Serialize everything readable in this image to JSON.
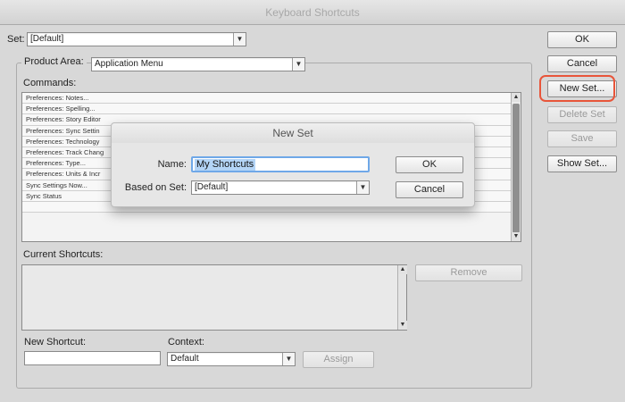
{
  "window": {
    "title": "Keyboard Shortcuts"
  },
  "set": {
    "label": "Set:",
    "value": "[Default]"
  },
  "product_area": {
    "label": "Product Area:",
    "value": "Application Menu"
  },
  "commands": {
    "label": "Commands:",
    "items": [
      "Preferences: Notes...",
      "Preferences: Spelling...",
      "Preferences: Story Editor",
      "Preferences: Sync Settin",
      "Preferences: Technology",
      "Preferences: Track Chang",
      "Preferences: Type...",
      "Preferences: Units & Incr",
      "Sync Settings Now...",
      "Sync Status",
      ""
    ]
  },
  "current_shortcuts": {
    "label": "Current Shortcuts:",
    "remove_label": "Remove"
  },
  "new_shortcut": {
    "label": "New Shortcut:",
    "value": ""
  },
  "context": {
    "label": "Context:",
    "value": "Default",
    "assign_label": "Assign"
  },
  "side_buttons": {
    "ok": "OK",
    "cancel": "Cancel",
    "new_set": "New Set...",
    "delete_set": "Delete Set",
    "save": "Save",
    "show_set": "Show Set..."
  },
  "new_set_dialog": {
    "title": "New Set",
    "name_label": "Name:",
    "name_value": "My Shortcuts",
    "based_on_label": "Based on Set:",
    "based_on_value": "[Default]",
    "ok": "OK",
    "cancel": "Cancel"
  },
  "colors": {
    "highlight_ring": "#e8553a",
    "focus_ring": "#6fa8e8",
    "selection": "#b3d4f6"
  }
}
